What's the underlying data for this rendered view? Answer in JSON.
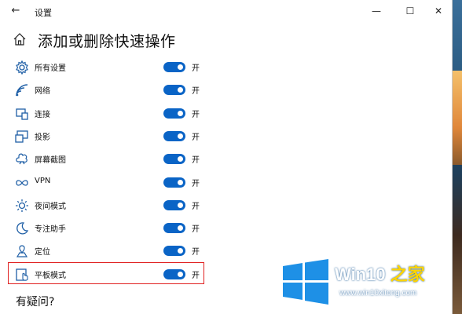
{
  "window": {
    "title": "设置",
    "back_glyph": "←",
    "controls": {
      "minimize": "—",
      "maximize": "☐",
      "close": "✕"
    }
  },
  "page": {
    "title": "添加或删除快速操作",
    "home_icon": "home-icon"
  },
  "quick_actions": [
    {
      "label": "所有设置",
      "state": "开",
      "on": true,
      "icon": "gear-icon"
    },
    {
      "label": "网络",
      "state": "开",
      "on": true,
      "icon": "wifi-icon"
    },
    {
      "label": "连接",
      "state": "开",
      "on": true,
      "icon": "connect-icon"
    },
    {
      "label": "投影",
      "state": "开",
      "on": true,
      "icon": "project-icon"
    },
    {
      "label": "屏幕截图",
      "state": "开",
      "on": true,
      "icon": "screenshot-icon"
    },
    {
      "label": "VPN",
      "state": "开",
      "on": true,
      "icon": "vpn-icon"
    },
    {
      "label": "夜间模式",
      "state": "开",
      "on": true,
      "icon": "night-light-icon"
    },
    {
      "label": "专注助手",
      "state": "开",
      "on": true,
      "icon": "moon-icon"
    },
    {
      "label": "定位",
      "state": "开",
      "on": true,
      "icon": "location-icon"
    },
    {
      "label": "平板模式",
      "state": "开",
      "on": true,
      "icon": "tablet-mode-icon"
    }
  ],
  "footer": {
    "question": "有疑问?"
  },
  "watermark": {
    "brand": "Win10",
    "brand_suffix": "之家",
    "url": "www.win10xitong.com"
  },
  "colors": {
    "accent": "#0a64c6",
    "highlight": "#e02020"
  }
}
